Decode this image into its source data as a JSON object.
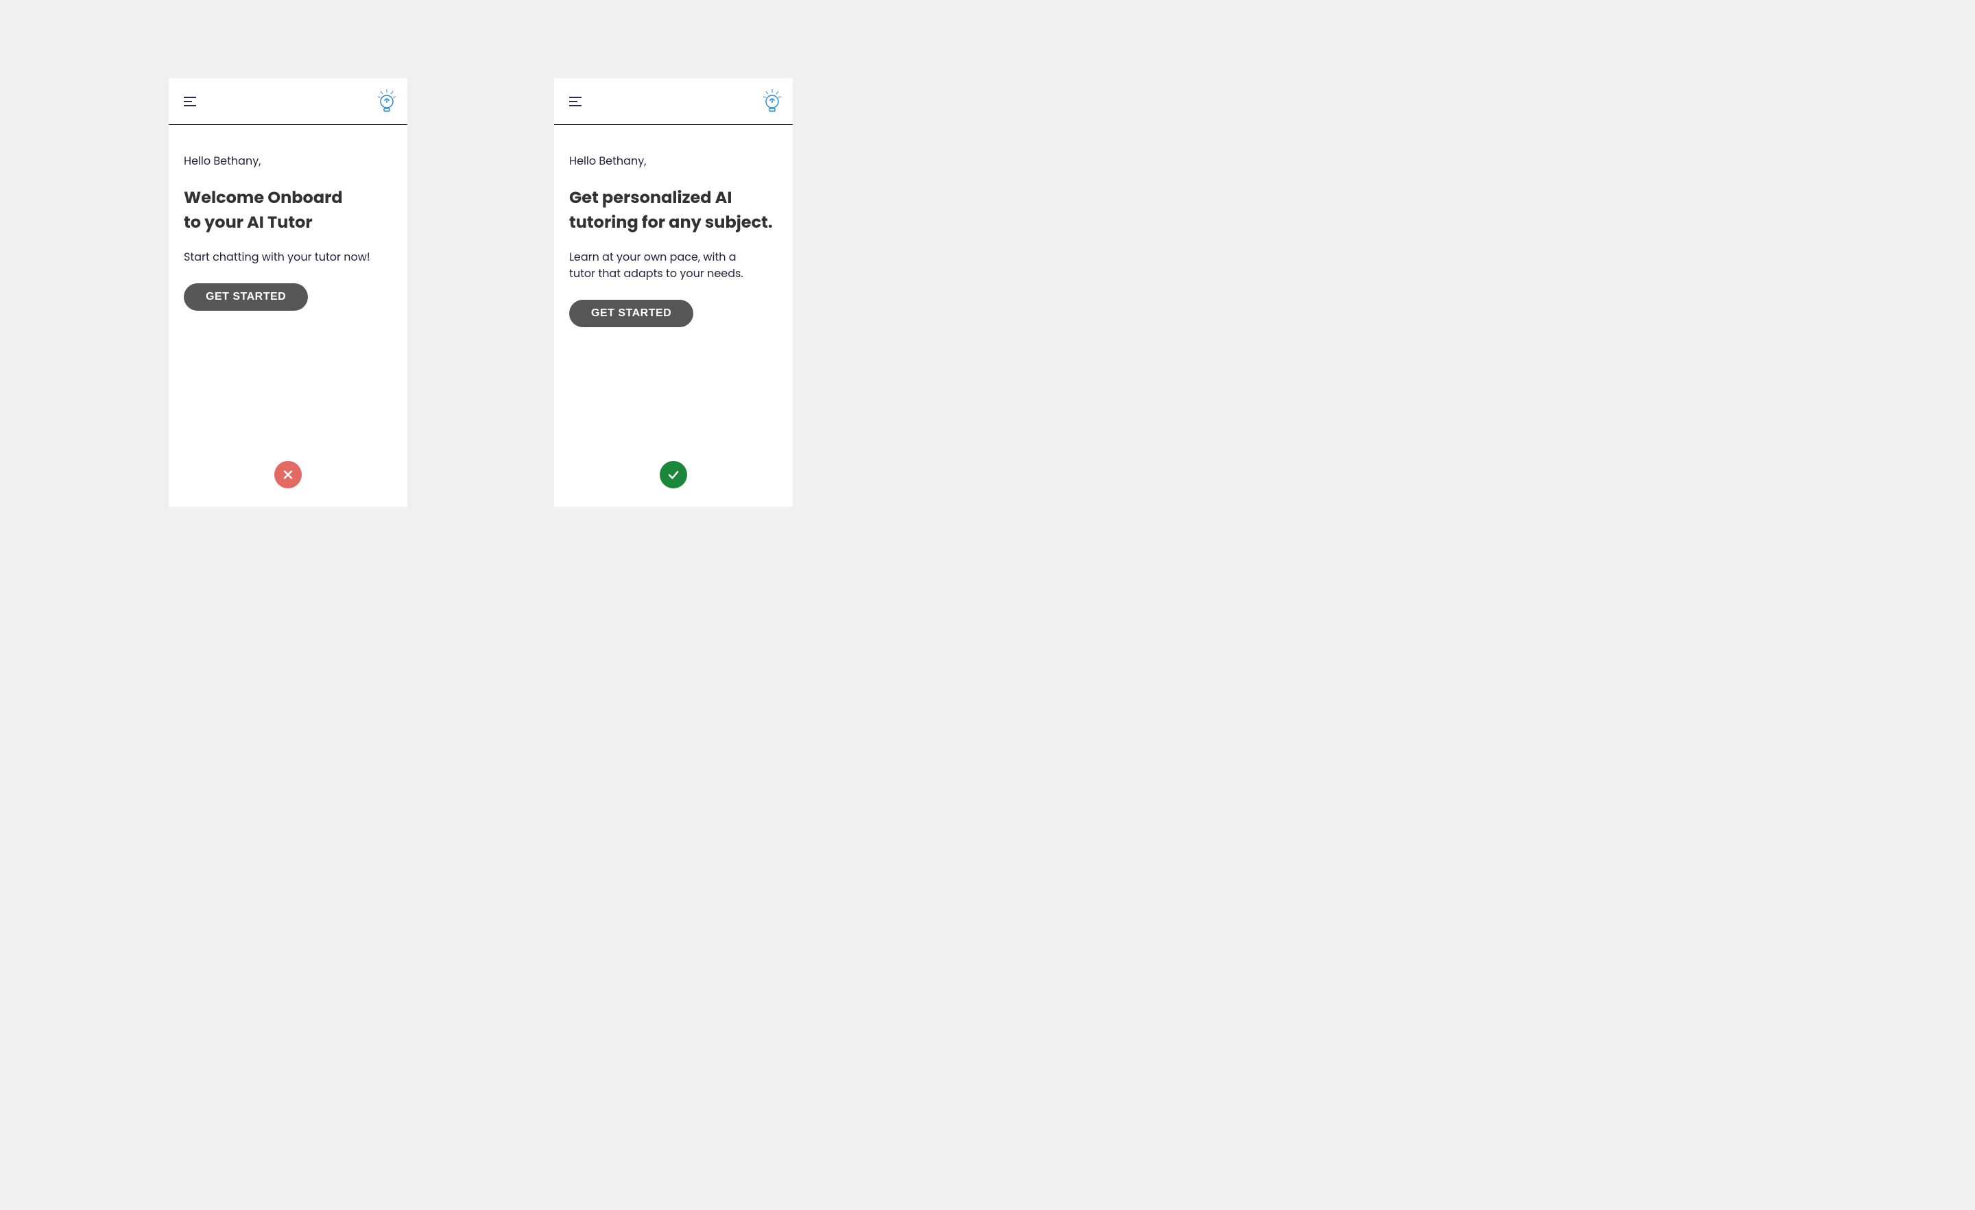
{
  "left": {
    "greeting": "Hello Bethany,",
    "heading_line1": "Welcome Onboard",
    "heading_line2": "to your AI Tutor",
    "subtext": "Start chatting with your tutor now!",
    "cta": "GET STARTED",
    "status": "bad"
  },
  "right": {
    "greeting": "Hello Bethany,",
    "heading_line1": "Get personalized AI",
    "heading_line2": "tutoring for any subject.",
    "subtext_line1": "Learn at your own pace,  with a",
    "subtext_line2": "tutor that adapts to your needs.",
    "cta": "GET STARTED",
    "status": "good"
  }
}
